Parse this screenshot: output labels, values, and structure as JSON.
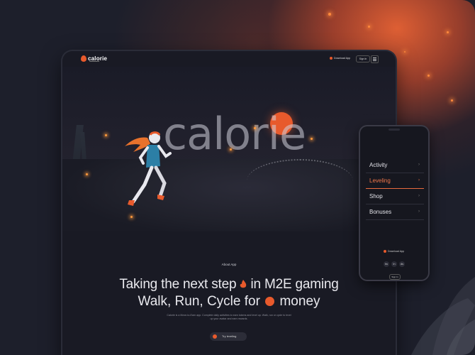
{
  "desktop": {
    "logo_text": "calorie",
    "nav": {
      "download_label": "Download App",
      "sign_in_label": "Sign In"
    },
    "hero_word": "calorie",
    "about_label": "About App",
    "headline_line1_a": "Taking the next step",
    "headline_line1_b": "in M2E gaming",
    "headline_line2_a": "Walk, Run, Cycle for",
    "headline_line2_b": "money",
    "description": "Calorie is a Move-to-Earn app. Complete daily activities to earn tokens and level up. Walk, run or cycle to level up your avatar and earn rewards.",
    "cta_label": "Try leveling"
  },
  "phone": {
    "menu": [
      {
        "label": "Activity",
        "active": false
      },
      {
        "label": "Leveling",
        "active": true
      },
      {
        "label": "Shop",
        "active": false
      },
      {
        "label": "Bonuses",
        "active": false
      }
    ],
    "download_label": "Download App",
    "social": [
      "tw",
      "in",
      "ds"
    ],
    "sign_in_label": "Sign In"
  },
  "colors": {
    "accent": "#e85a2c",
    "background": "#1d1f2b",
    "active_text": "#f0764a"
  }
}
